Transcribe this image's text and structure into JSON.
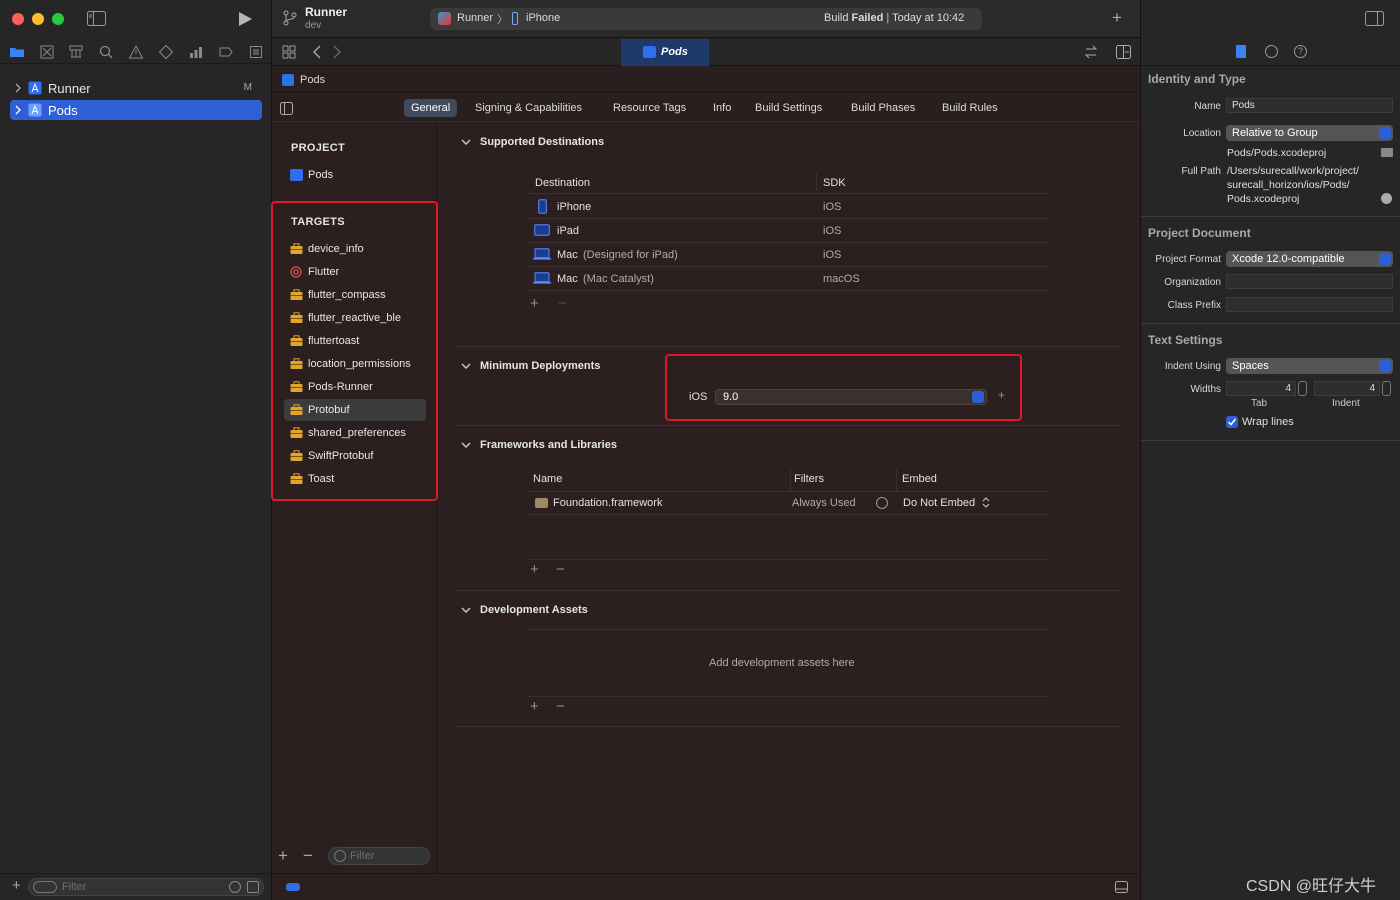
{
  "window": {
    "scheme_title": "Runner",
    "scheme_subtitle": "dev",
    "status": {
      "scheme": "Runner",
      "device": "iPhone",
      "build_label": "Build",
      "build_state": "Failed",
      "build_time": "Today at 10:42"
    }
  },
  "navigator": {
    "items": [
      {
        "label": "Runner",
        "badge": "M"
      },
      {
        "label": "Pods",
        "badge": ""
      }
    ],
    "filter_placeholder": "Filter"
  },
  "editor": {
    "tab": "Pods",
    "jump_bar": "Pods",
    "segments": [
      "General",
      "Signing & Capabilities",
      "Resource Tags",
      "Info",
      "Build Settings",
      "Build Phases",
      "Build Rules"
    ],
    "active_segment": "General",
    "project_header": "PROJECT",
    "project_item": "Pods",
    "targets_header": "TARGETS",
    "targets": [
      {
        "label": "device_info",
        "icon": "toolbox-icon"
      },
      {
        "label": "Flutter",
        "icon": "target-icon"
      },
      {
        "label": "flutter_compass",
        "icon": "toolbox-icon"
      },
      {
        "label": "flutter_reactive_ble",
        "icon": "toolbox-icon"
      },
      {
        "label": "fluttertoast",
        "icon": "toolbox-icon"
      },
      {
        "label": "location_permissions",
        "icon": "toolbox-icon"
      },
      {
        "label": "Pods-Runner",
        "icon": "toolbox-icon"
      },
      {
        "label": "Protobuf",
        "icon": "toolbox-icon"
      },
      {
        "label": "shared_preferences",
        "icon": "toolbox-icon"
      },
      {
        "label": "SwiftProtobuf",
        "icon": "toolbox-icon"
      },
      {
        "label": "Toast",
        "icon": "toolbox-icon"
      }
    ],
    "selected_target": "Protobuf",
    "targets_filter_placeholder": "Filter",
    "supported_destinations": {
      "title": "Supported Destinations",
      "col_destination": "Destination",
      "col_sdk": "SDK",
      "rows": [
        {
          "name": "iPhone",
          "suffix": "",
          "sdk": "iOS",
          "icon": "iphone-icon"
        },
        {
          "name": "iPad",
          "suffix": "",
          "sdk": "iOS",
          "icon": "ipad-icon"
        },
        {
          "name": "Mac",
          "suffix": "(Designed for iPad)",
          "sdk": "iOS",
          "icon": "mac-icon"
        },
        {
          "name": "Mac",
          "suffix": "(Mac Catalyst)",
          "sdk": "macOS",
          "icon": "mac-icon"
        }
      ]
    },
    "minimum_deployments": {
      "title": "Minimum Deployments",
      "platform": "iOS",
      "version": "9.0"
    },
    "frameworks": {
      "title": "Frameworks and Libraries",
      "col_name": "Name",
      "col_filters": "Filters",
      "col_embed": "Embed",
      "rows": [
        {
          "name": "Foundation.framework",
          "filters": "Always Used",
          "embed": "Do Not Embed"
        }
      ]
    },
    "development_assets": {
      "title": "Development Assets",
      "empty_text": "Add development assets here"
    }
  },
  "inspector": {
    "identity": {
      "title": "Identity and Type",
      "name_label": "Name",
      "name_value": "Pods",
      "location_label": "Location",
      "location_value": "Relative to Group",
      "location_path": "Pods/Pods.xcodeproj",
      "full_path_label": "Full Path",
      "full_path_lines": [
        "/Users/surecall/work/project/",
        "surecall_horizon/ios/Pods/",
        "Pods.xcodeproj"
      ]
    },
    "project_document": {
      "title": "Project Document",
      "format_label": "Project Format",
      "format_value": "Xcode 12.0-compatible",
      "org_label": "Organization",
      "org_value": "",
      "prefix_label": "Class Prefix",
      "prefix_value": ""
    },
    "text_settings": {
      "title": "Text Settings",
      "indent_label": "Indent Using",
      "indent_value": "Spaces",
      "widths_label": "Widths",
      "tab_value": "4",
      "indent_width_value": "4",
      "tab_caption": "Tab",
      "indent_caption": "Indent",
      "wrap_label": "Wrap lines",
      "wrap_checked": true
    }
  },
  "watermark": "CSDN @旺仔大牛",
  "colors": {
    "accent": "#2f5fd6",
    "highlight_box": "#e0162b",
    "build_failed": "#ffffff"
  }
}
